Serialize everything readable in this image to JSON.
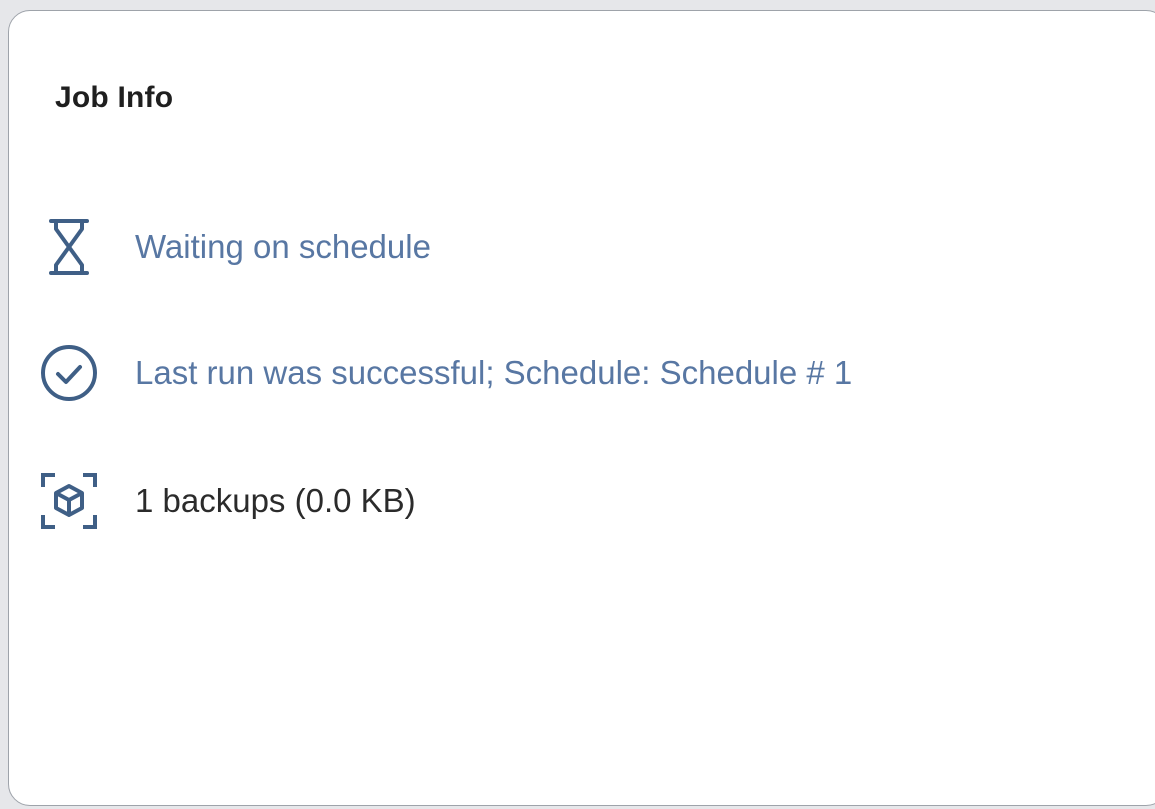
{
  "panel": {
    "title": "Job Info"
  },
  "items": [
    {
      "icon": "hourglass-icon",
      "text": "Waiting on schedule"
    },
    {
      "icon": "check-circle-icon",
      "text": "Last run was successful; Schedule: Schedule # 1"
    },
    {
      "icon": "backup-box-icon",
      "text": "1 backups (0.0 KB)"
    }
  ],
  "colors": {
    "icon": "#3f5f86",
    "muted_text": "#5877a3",
    "dark_text": "#2b2b2b"
  }
}
